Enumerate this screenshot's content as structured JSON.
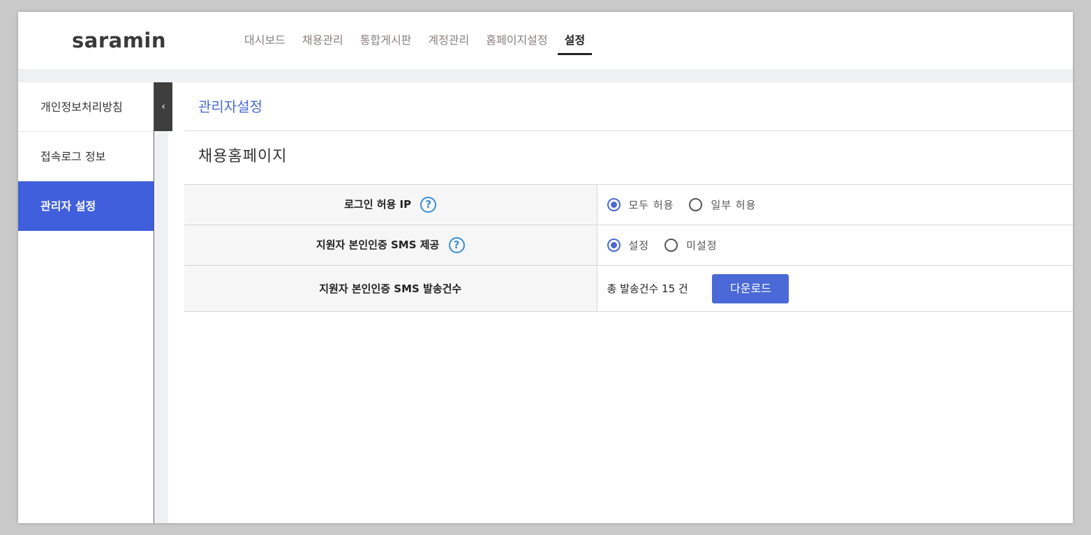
{
  "header": {
    "logo_text": "saramin",
    "nav": [
      {
        "label": "대시보드"
      },
      {
        "label": "채용관리"
      },
      {
        "label": "통합게시판"
      },
      {
        "label": "계정관리"
      },
      {
        "label": "홈페이지설정"
      },
      {
        "label": "설정",
        "active": true
      }
    ]
  },
  "sidebar": {
    "items": [
      {
        "label": "개인정보처리방침"
      },
      {
        "label": "접속로그 정보"
      },
      {
        "label": "관리자 설정",
        "active": true
      }
    ],
    "collapse_glyph": "‹"
  },
  "main": {
    "page_title": "관리자설정",
    "section_title": "채용홈페이지",
    "rows": [
      {
        "label": "로그인 허용 IP",
        "help": "?",
        "options": [
          {
            "label": "모두 허용",
            "checked": true
          },
          {
            "label": "일부 허용",
            "checked": false
          }
        ]
      },
      {
        "label": "지원자 본인인증 SMS 제공",
        "help": "?",
        "options": [
          {
            "label": "설정",
            "checked": true
          },
          {
            "label": "미설정",
            "checked": false
          }
        ]
      },
      {
        "label": "지원자 본인인증 SMS 발송건수",
        "count_text": "총 발송건수 15 건",
        "button_label": "다운로드"
      }
    ]
  },
  "colors": {
    "accent": "#4a69d6",
    "sidebar_active": "#3f5fdc",
    "help_icon": "#3a8ed6"
  }
}
